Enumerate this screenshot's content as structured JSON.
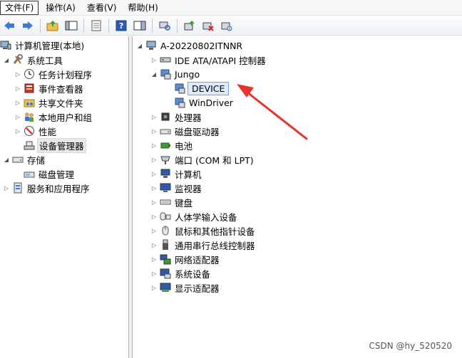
{
  "menubar": {
    "items": [
      "文件(F)",
      "操作(A)",
      "查看(V)",
      "帮助(H)"
    ]
  },
  "toolbar": {
    "buttons": [
      "back-icon",
      "forward-icon",
      "up-folder-icon",
      "show-hide-tree-icon",
      "properties-icon",
      "help-icon",
      "show-hide-action-pane-icon",
      "scan-hardware-icon",
      "update-driver-icon",
      "disable-device-icon",
      "uninstall-device-icon"
    ]
  },
  "left_tree": {
    "root": "计算机管理(本地)",
    "system_tools": "系统工具",
    "task_scheduler": "任务计划程序",
    "event_viewer": "事件查看器",
    "shared_folders": "共享文件夹",
    "local_users": "本地用户和组",
    "performance": "性能",
    "device_manager": "设备管理器",
    "storage": "存储",
    "disk_management": "磁盘管理",
    "services_apps": "服务和应用程序"
  },
  "device_tree": {
    "computer": "A-20220802ITNNR",
    "categories": {
      "ide": "IDE ATA/ATAPI 控制器",
      "jungo": "Jungo",
      "jungo_device": "DEVICE",
      "jungo_windriver": "WinDriver",
      "processor": "处理器",
      "disk_drive": "磁盘驱动器",
      "battery": "电池",
      "ports": "端口 (COM 和 LPT)",
      "computer": "计算机",
      "monitor": "监视器",
      "keyboard": "键盘",
      "hid": "人体学输入设备",
      "mouse": "鼠标和其他指针设备",
      "usb": "通用串行总线控制器",
      "network": "网络适配器",
      "system": "系统设备",
      "display": "显示适配器"
    }
  },
  "annotation": {
    "arrow_color": "#e8322b"
  },
  "watermark": "CSDN @hy_520520"
}
